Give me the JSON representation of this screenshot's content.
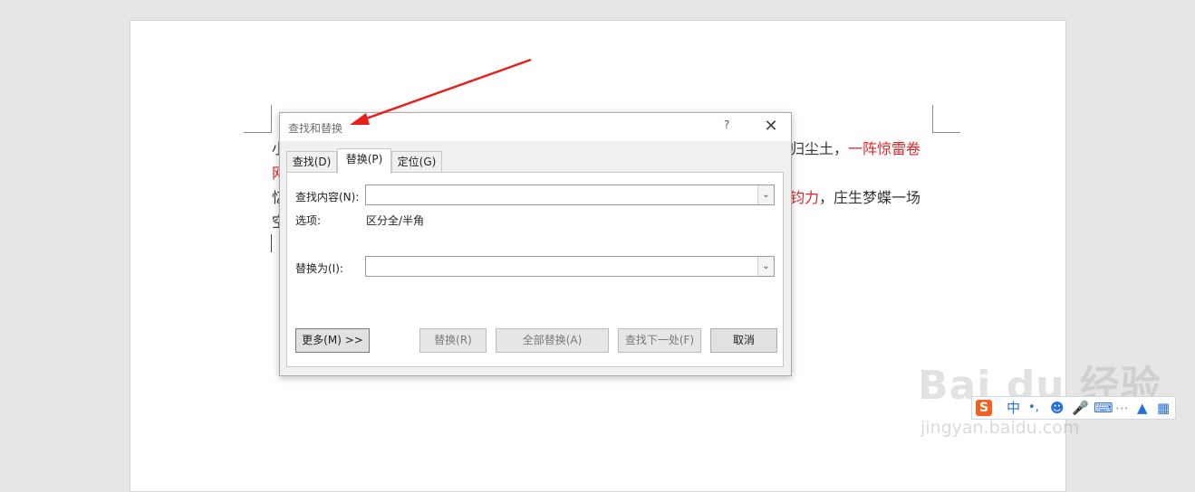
{
  "document": {
    "line1_left": "小",
    "line1_right_plain": "归尘土，",
    "line1_right_red": "一阵惊雷卷",
    "line2_left_red": "网",
    "line3_left": "忆",
    "line3_right_red": "钧力",
    "line3_right_plain": "，庄生梦蝶一场",
    "line4_left": "空"
  },
  "dialog": {
    "title": "查找和替换",
    "help_label": "?",
    "close_label": "✕",
    "tabs": [
      {
        "label": "查找(D)",
        "active": false
      },
      {
        "label": "替换(P)",
        "active": true
      },
      {
        "label": "定位(G)",
        "active": false
      }
    ],
    "find": {
      "label": "查找内容(N):",
      "value": ""
    },
    "options": {
      "label": "选项:",
      "value": "区分全/半角"
    },
    "replace": {
      "label": "替换为(I):",
      "value": ""
    },
    "buttons": {
      "more": "更多(M) >>",
      "replace": "替换(R)",
      "replace_all": "全部替换(A)",
      "find_next": "查找下一处(F)",
      "cancel": "取消"
    }
  },
  "ime_toolbar": {
    "logo": "S",
    "mode": "中",
    "punct": "•,"
  },
  "watermark": {
    "main": "Bai du 经验",
    "sub": "jingyan.baidu.com"
  },
  "colors": {
    "annotation_arrow": "#e8201c",
    "highlight_text": "#e0262a",
    "ime_accent": "#2a6fd6"
  }
}
